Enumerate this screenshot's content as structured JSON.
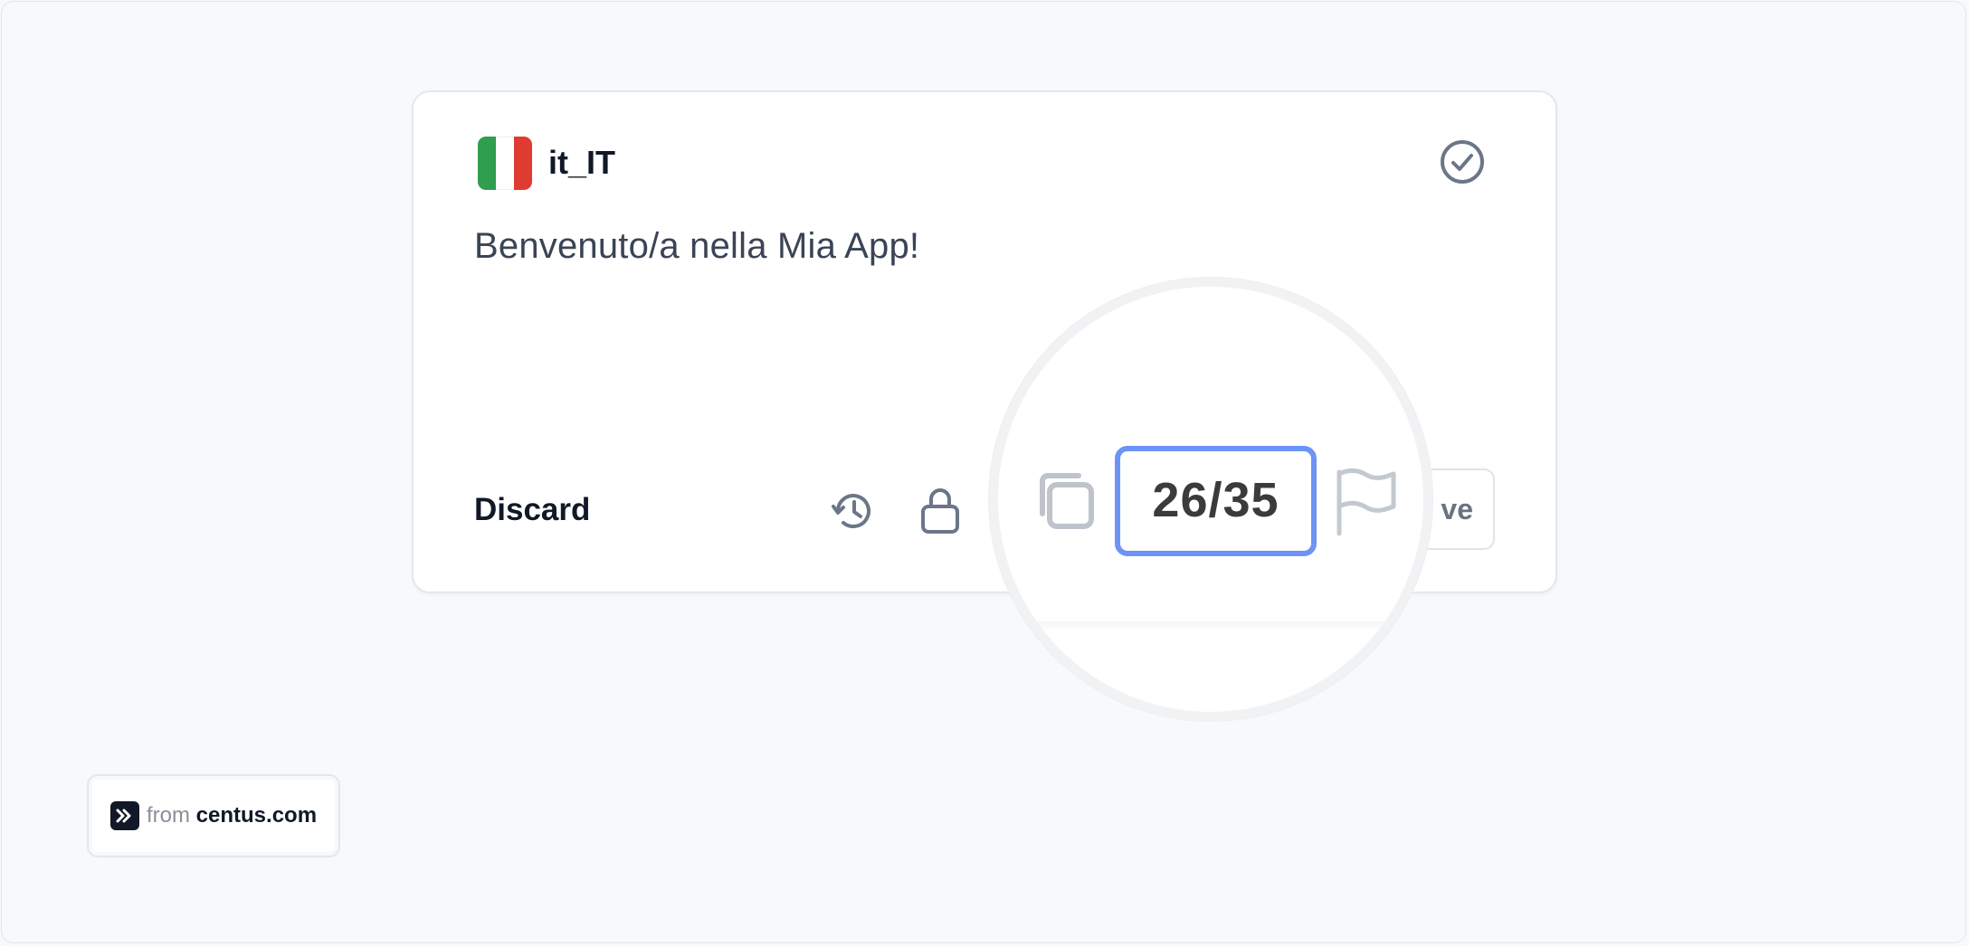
{
  "card": {
    "locale_code": "it_IT",
    "flag_colors": [
      "#2f9e4f",
      "#ffffff",
      "#e03b30"
    ],
    "translation_text": "Benvenuto/a nella Mia App!",
    "discard_label": "Discard",
    "save_label_visible": "ve",
    "icons": [
      "check-circle-icon",
      "history-icon",
      "lock-icon",
      "copy-icon",
      "flag-icon"
    ]
  },
  "magnifier": {
    "counter": "26/35",
    "counter_border_color": "#6c93f6"
  },
  "badge": {
    "prefix": "from",
    "domain": "centus.com",
    "icon": "double-chevron-right-icon"
  }
}
